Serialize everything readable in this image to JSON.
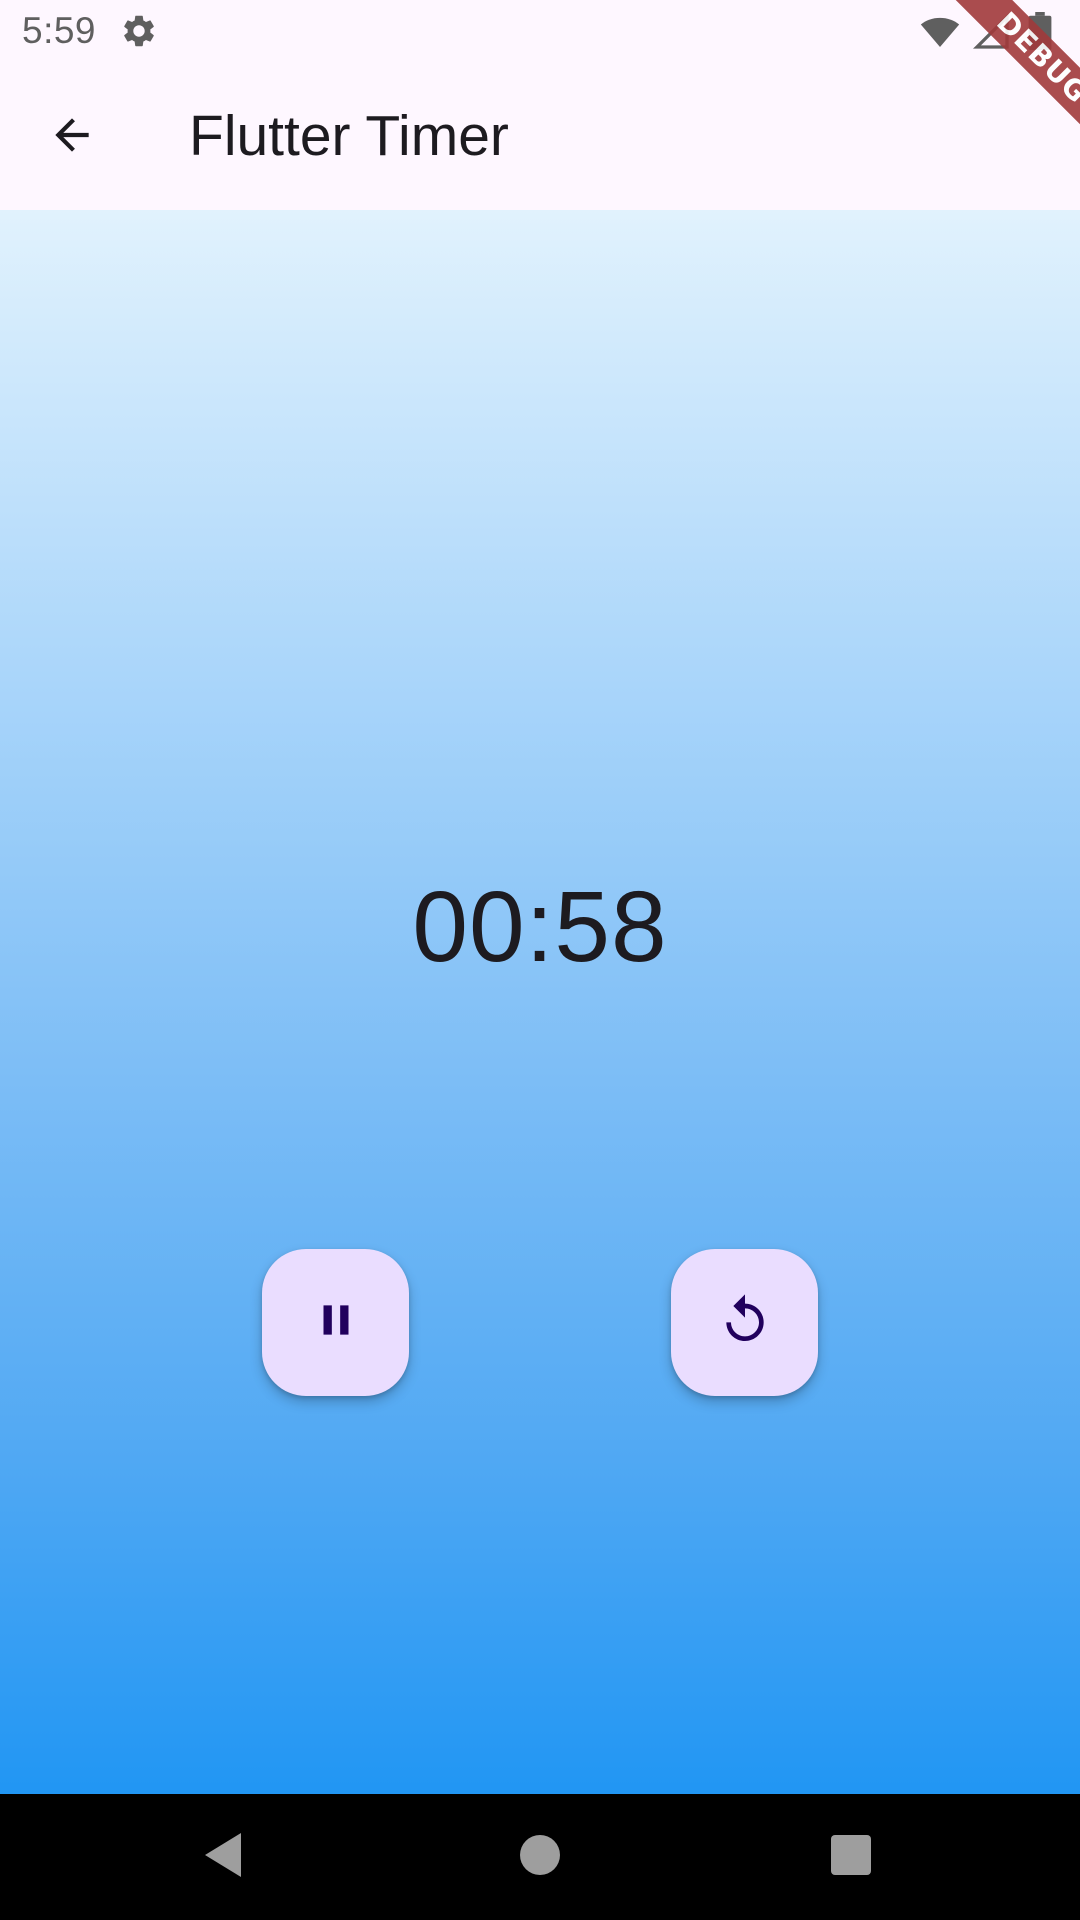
{
  "status_bar": {
    "time": "5:59",
    "icons": [
      "settings-icon",
      "wifi-icon",
      "cellular-icon",
      "battery-icon"
    ]
  },
  "app_bar": {
    "back_icon": "arrow-back-icon",
    "title": "Flutter Timer"
  },
  "timer": {
    "display": "00:58"
  },
  "actions": {
    "pause_icon": "pause-icon",
    "reset_icon": "replay-icon"
  },
  "debug_banner": {
    "label": "DEBUG"
  },
  "nav_bar": {
    "icons": [
      "nav-back-icon",
      "nav-home-icon",
      "nav-recents-icon"
    ]
  },
  "colors": {
    "surface": "#fef7ff",
    "fab_background": "#eaddff",
    "fab_icon": "#21005d",
    "text_primary": "#1d1b20",
    "gradient_top": "#e1f2fd",
    "gradient_bottom": "#2196f3",
    "debug_banner": "#a13a3b",
    "nav_bar": "#000000"
  }
}
